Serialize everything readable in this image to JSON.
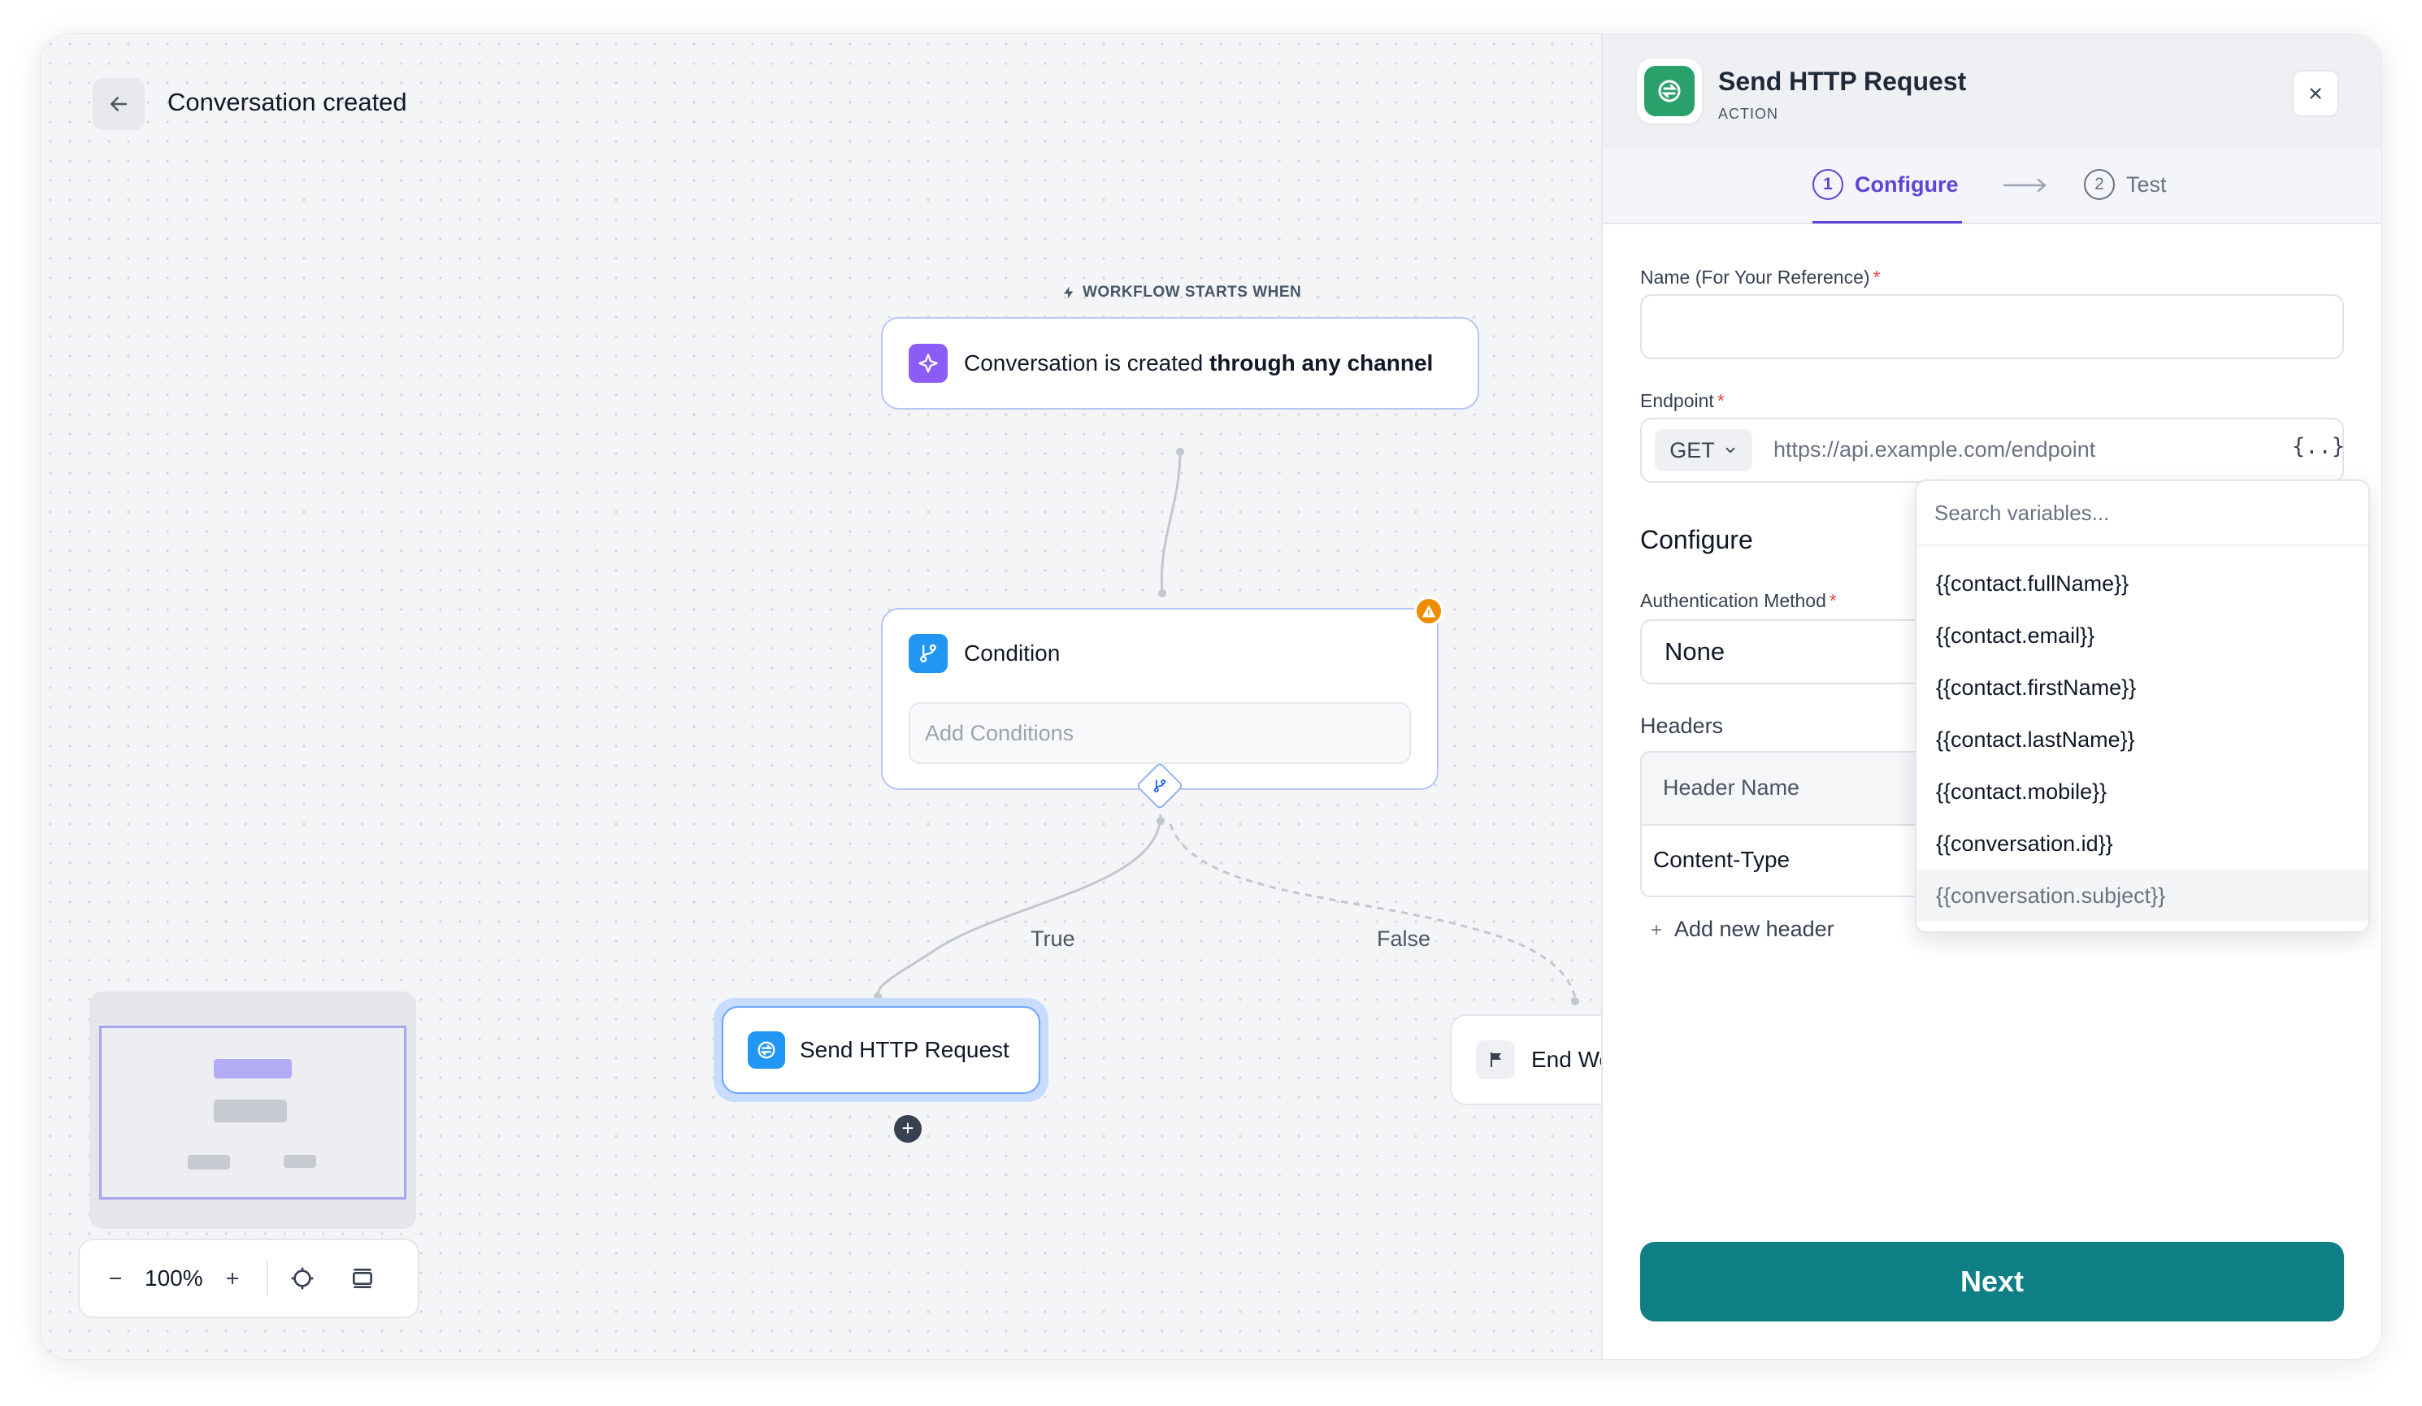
{
  "canvas": {
    "page_title": "Conversation created",
    "starts_label": "WORKFLOW STARTS WHEN",
    "trigger": {
      "text_plain": "Conversation is created ",
      "text_bold": "through any channel"
    },
    "condition": {
      "title": "Condition",
      "placeholder": "Add Conditions"
    },
    "edges": {
      "true_label": "True",
      "false_label": "False"
    },
    "http_node": {
      "title": "Send HTTP Request"
    },
    "end_node": {
      "title": "End Wo"
    },
    "zoom": {
      "value": "100%"
    }
  },
  "panel": {
    "title": "Send HTTP Request",
    "subtitle": "ACTION",
    "steps": [
      {
        "num": "1",
        "label": "Configure"
      },
      {
        "num": "2",
        "label": "Test"
      }
    ],
    "name_field": {
      "label": "Name (For Your Reference)",
      "required": "*",
      "value": ""
    },
    "endpoint": {
      "label": "Endpoint",
      "required": "*",
      "method": "GET",
      "placeholder": "https://api.example.com/endpoint",
      "var_button": "{..}"
    },
    "configure_title": "Configure",
    "auth": {
      "label": "Authentication Method",
      "required": "*",
      "value": "None"
    },
    "headers": {
      "title": "Headers",
      "column_name": "Header Name",
      "rows": [
        {
          "name": "Content-Type"
        }
      ],
      "add_label": "Add new header"
    },
    "variables_dropdown": {
      "search_placeholder": "Search variables...",
      "items": [
        "{{contact.fullName}}",
        "{{contact.email}}",
        "{{contact.firstName}}",
        "{{contact.lastName}}",
        "{{contact.mobile}}",
        "{{conversation.id}}",
        "{{conversation.subject}}"
      ]
    },
    "next_label": "Next"
  },
  "colors": {
    "accent": "#5b45d6",
    "primary_button": "#0f7f86",
    "action_icon": "#2aa06a",
    "node_blue": "#2196f3",
    "trigger_purple": "#8b5cf6",
    "warning": "#f08c00"
  },
  "icons": {
    "back": "arrow-left-icon",
    "trigger": "sparkle-icon",
    "condition": "branch-icon",
    "warning": "warning-icon",
    "http": "globe-icon",
    "end": "flag-icon",
    "close": "close-icon",
    "variables": "braces-icon",
    "step_arrow": "arrow-right-icon"
  }
}
